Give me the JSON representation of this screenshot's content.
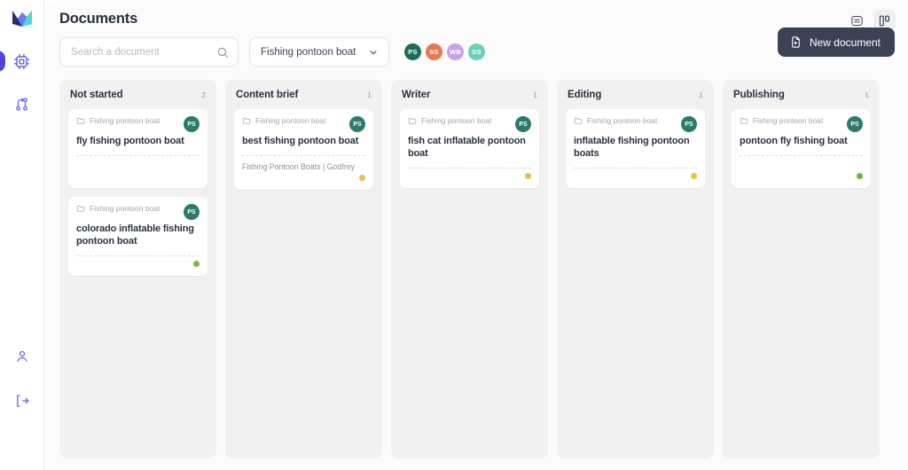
{
  "sidebar": {
    "logo": "app-logo",
    "top_items": [
      {
        "icon": "cpu-chip-icon",
        "name": "nav-item-ai",
        "active": true
      },
      {
        "icon": "git-branch-icon",
        "name": "nav-item-workflow",
        "active": false
      }
    ],
    "bottom_items": [
      {
        "icon": "user-icon",
        "name": "nav-item-account",
        "active": false
      },
      {
        "icon": "logout-icon",
        "name": "nav-item-logout",
        "active": false
      }
    ],
    "accent_color": "#4f46d9"
  },
  "header": {
    "title": "Documents",
    "view_list_icon": "list-view-icon",
    "view_board_icon": "board-view-icon",
    "active_view": "board"
  },
  "toolbar": {
    "search_placeholder": "Search a document",
    "search_value": "",
    "search_icon": "search-icon",
    "project_select_value": "Fishing pontoon boat",
    "chevron_icon": "chevron-down-icon",
    "avatars": [
      {
        "initials": "PS",
        "color": "#1f6b5e"
      },
      {
        "initials": "SS",
        "color": "#e8794f"
      },
      {
        "initials": "WB",
        "color": "#c9a3e8"
      },
      {
        "initials": "SS",
        "color": "#6dcfb8"
      }
    ],
    "new_document_label": "New document",
    "new_document_icon": "file-plus-icon",
    "new_document_color": "#3b4256"
  },
  "board": {
    "columns": [
      {
        "title": "Not started",
        "count": "2",
        "cards": [
          {
            "folder_icon": "folder-icon",
            "folder": "Fishing pontoon boat",
            "avatar": "PS",
            "title": "fly fishing pontoon boat",
            "subtitle": "",
            "status_dot": ""
          },
          {
            "folder_icon": "folder-icon",
            "folder": "Fishing pontoon boat",
            "avatar": "PS",
            "title": "colorado inflatable fishing pontoon boat",
            "subtitle": "",
            "status_dot": "#7ab83f"
          }
        ]
      },
      {
        "title": "Content brief",
        "count": "1",
        "cards": [
          {
            "folder_icon": "folder-icon",
            "folder": "Fishing pontoon boat",
            "avatar": "PS",
            "title": "best fishing pontoon boat",
            "subtitle": "Fishing Pontoon Boats | Godfrey",
            "status_dot": "#e8c24a"
          }
        ]
      },
      {
        "title": "Writer",
        "count": "1",
        "cards": [
          {
            "folder_icon": "folder-icon",
            "folder": "Fishing pontoon boat",
            "avatar": "PS",
            "title": "fish cat inflatable pontoon boat",
            "subtitle": "",
            "status_dot": "#e8c24a"
          }
        ]
      },
      {
        "title": "Editing",
        "count": "1",
        "cards": [
          {
            "folder_icon": "folder-icon",
            "folder": "Fishing pontoon boat",
            "avatar": "PS",
            "title": "inflatable fishing pontoon boats",
            "subtitle": "",
            "status_dot": "#e8c24a"
          }
        ]
      },
      {
        "title": "Publishing",
        "count": "1",
        "cards": [
          {
            "folder_icon": "folder-icon",
            "folder": "Fishing pontoon boat",
            "avatar": "PS",
            "title": "pontoon fly fishing boat",
            "subtitle": "",
            "status_dot": "#66bb2e"
          }
        ]
      }
    ]
  }
}
